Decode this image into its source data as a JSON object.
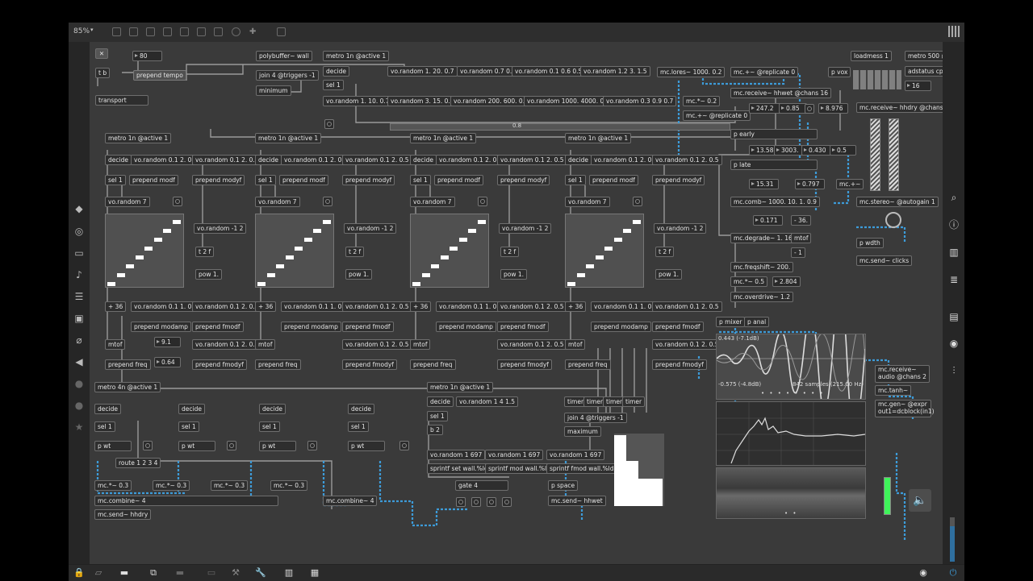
{
  "app": {
    "zoom_label": "85%",
    "colors": {
      "background": "#3a3a3a",
      "object_fill": "#2e2e2e",
      "message_fill": "#505050",
      "signal_wire": "#3d9bd8",
      "control_wire": "#9a9a9a",
      "meter_green": "#3ff35a"
    }
  },
  "toolbar": {
    "icons": [
      "presentation-icon",
      "patcher-icon",
      "new-object-icon",
      "close-icon",
      "object-box-icon",
      "inspector-icon",
      "comment-icon",
      "timer-icon",
      "pin-icon",
      "lock-icon",
      "grid-icon"
    ]
  },
  "leftbar": {
    "icons": [
      "cube-icon",
      "circle-icon",
      "box-icon",
      "music-note-icon",
      "list-icon",
      "image-icon",
      "attach-icon",
      "plugin-icon",
      "record-icon",
      "help-icon",
      "star-icon"
    ]
  },
  "rightbar": {
    "icons": [
      "search-icon",
      "info-icon",
      "book-icon",
      "list-icon",
      "docs-icon",
      "camera-icon",
      "mixer-icon"
    ]
  },
  "bottombar": {
    "icons": [
      "lock-icon",
      "presentation-icon",
      "comment-icon",
      "window-icon",
      "align-icon",
      "debug-icon",
      "wrench-icon",
      "piano-icon",
      "grid-icon",
      "audio-status-icon",
      "power-icon"
    ]
  },
  "patch": {
    "top": {
      "close_label": "✕",
      "num_80": "80",
      "t_b": "t b",
      "prepend_tempo": "prepend tempo",
      "transport": "transport",
      "polybuffer": "polybuffer~ wall",
      "join": "join 4 @triggers -1",
      "minimum": "minimum",
      "metro_top": "metro 1n @active 1",
      "decide": "decide",
      "sel1": "sel 1",
      "r1": "vo.random 1. 20. 0.7",
      "r2": "vo.random 0.7 0.9",
      "r3": "vo.random 0.1 0.6 0.5",
      "r4": "vo.random 1.2 3. 1.5",
      "r5": "vo.random 1. 10. 0.7",
      "r6": "vo.random 3. 15. 0.7",
      "r7": "vo.random 200. 600. 0.7",
      "r8": "vo.random 1000. 4000. 0.5",
      "r9": "vo.random 0.3 0.9 0.7",
      "val_08": "0.8"
    },
    "voices": [
      {
        "metro": "metro 1n @active 1",
        "decide": "decide",
        "r_a": "vo.random 0.1 2. 0.5",
        "r_b": "vo.random 0.1 2. 0.5",
        "sel1": "sel 1",
        "pmodf": "prepend modf",
        "pmodyf": "prepend modyf",
        "rnd7": "vo.random 7",
        "rneg": "vo.random -1 2",
        "t2f": "t 2 f",
        "pow": "pow 1.",
        "p36": "+ 36",
        "r_c": "vo.random 0.1 1. 0.5",
        "r_d": "vo.random 0.1 2. 0.5",
        "pmodamp": "prepend modamp",
        "pfmodf": "prepend fmodf",
        "r_e": "vo.random 0.1 2. 0.5",
        "mtof": "mtof",
        "pfreq": "prepend freq",
        "pfmodyf": "prepend fmodyf"
      },
      {
        "metro": "metro 1n @active 1",
        "decide": "decide",
        "r_a": "vo.random 0.1 2. 0.5",
        "r_b": "vo.random 0.1 2. 0.5",
        "sel1": "sel 1",
        "pmodf": "prepend modf",
        "pmodyf": "prepend modyf",
        "rnd7": "vo.random 7",
        "rneg": "vo.random -1 2",
        "t2f": "t 2 f",
        "pow": "pow 1.",
        "p36": "+ 36",
        "r_c": "vo.random 0.1 1. 0.5",
        "r_d": "vo.random 0.1 2. 0.5",
        "pmodamp": "prepend modamp",
        "pfmodf": "prepend fmodf",
        "r_e": "vo.random 0.1 2. 0.5",
        "mtof": "mtof",
        "pfreq": "prepend freq",
        "pfmodyf": "prepend fmodyf"
      },
      {
        "metro": "metro 1n @active 1",
        "decide": "decide",
        "r_a": "vo.random 0.1 2. 0.5",
        "r_b": "vo.random 0.1 2. 0.5",
        "sel1": "sel 1",
        "pmodf": "prepend modf",
        "pmodyf": "prepend modyf",
        "rnd7": "vo.random 7",
        "rneg": "vo.random -1 2",
        "t2f": "t 2 f",
        "pow": "pow 1.",
        "p36": "+ 36",
        "r_c": "vo.random 0.1 1. 0.5",
        "r_d": "vo.random 0.1 2. 0.5",
        "pmodamp": "prepend modamp",
        "pfmodf": "prepend fmodf",
        "r_e": "vo.random 0.1 2. 0.5",
        "mtof": "mtof",
        "pfreq": "prepend freq",
        "pfmodyf": "prepend fmodyf"
      },
      {
        "metro": "metro 1n @active 1",
        "decide": "decide",
        "r_a": "vo.random 0.1 2. 0.5",
        "r_b": "vo.random 0.1 2. 0.5",
        "sel1": "sel 1",
        "pmodf": "prepend modf",
        "pmodyf": "prepend modyf",
        "rnd7": "vo.random 7",
        "rneg": "vo.random -1 2",
        "t2f": "t 2 f",
        "pow": "pow 1.",
        "p36": "+ 36",
        "r_c": "vo.random 0.1 1. 0.5",
        "r_d": "vo.random 0.1 2. 0.5",
        "pmodamp": "prepend modamp",
        "pfmodf": "prepend fmodf",
        "r_e": "vo.random 0.1 2. 0.5",
        "mtof": "mtof",
        "pfreq": "prepend freq",
        "pfmodyf": "prepend fmodyf"
      }
    ],
    "num_91": "9.1",
    "num_064": "0.64",
    "bottom": {
      "metro4n": "metro 4n @active 1",
      "decide": "decide",
      "sel1": "sel 1",
      "pwt": "p wt",
      "route": "route 1 2 3 4",
      "mc03": "mc.*~ 0.3",
      "mccombine4": "mc.combine~ 4",
      "mcsend": "mc.send~ hhdry",
      "metro1n": "metro 1n @active 1",
      "rnd1415": "vo.random 1 4 1.5",
      "b2": "b 2",
      "r1697": "vo.random 1 697",
      "sprintf1": "sprintf set wall.%ld",
      "sprintf2": "sprintf mod wall.%ld",
      "sprintf3": "sprintf fmod wall.%ld",
      "gate": "gate 4",
      "timer": "timer",
      "join4": "join 4 @triggers -1",
      "maximum": "maximum",
      "pspace": "p space",
      "mcsendhhwet": "mc.send~ hhwet"
    },
    "right": {
      "mclores": "mc.lores~ 1000. 0.2",
      "mcrep0": "mc.+~ @replicate 0",
      "mcmul02": "mc.*~ 0.2",
      "mcrep0b": "mc.+~ @replicate 0",
      "mcreceive": "mc.receive~ hhwet @chans 16",
      "n2472": "247.2",
      "n085": "0.85",
      "n8976": "8.976",
      "pearly": "p early",
      "n1358": "13.58",
      "n3003": "3003.",
      "n0430": "0.430",
      "n05": "0.5",
      "plate": "p late",
      "n1531": "15.31",
      "n0797": "0.797",
      "mcplus": "mc.+~",
      "mccomb": "mc.comb~ 1000. 10. 1. 0.9",
      "n0171": "0.171",
      "n36": "- 36.",
      "mcdegrade": "mc.degrade~ 1. 16.",
      "mtof": "mtof",
      "neg1": "- 1",
      "mcfreq": "mc.freqshift~ 200.",
      "mc05": "mc.*~ 0.5",
      "n2804": "2.804",
      "mcod": "mc.overdrive~ 1.2",
      "pmixer": "p mixer",
      "panal": "p anal",
      "pvox": "p vox",
      "loadmess": "loadmess 1",
      "metro500": "metro 500 @a",
      "adstatus": "adstatus cpu",
      "n16": "16",
      "mcrecvhh": "mc.receive~ hhdry @chans 16",
      "mcstereo": "mc.stereo~ @autogain 1",
      "pwdth": "p wdth",
      "mcsendclicks": "mc.send~ clicks",
      "mcrecaudio": "mc.receive~ audio @chans 2",
      "mctanh": "mc.tanh~",
      "mcgen": "mc.gen~ @expr out1=dcblock(in1)"
    },
    "scope": {
      "max_label": "0.443 (-7.1dB)",
      "min_label": "-0.575 (-4.8dB)",
      "samples_label": "842 samples (215.00 Hz)"
    }
  }
}
